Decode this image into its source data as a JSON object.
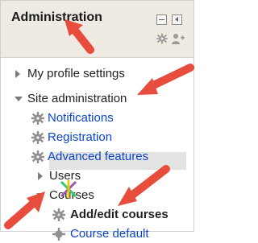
{
  "block": {
    "title": "Administration",
    "header_icons": [
      "dock-icon",
      "hide-icon",
      "gear-icon",
      "add-person-icon"
    ]
  },
  "tree": {
    "my_profile_settings": "My profile settings",
    "site_administration": "Site administration",
    "notifications": "Notifications",
    "registration": "Registration",
    "advanced_features": "Advanced features",
    "users": "Users",
    "courses": "Courses",
    "add_edit_courses": "Add/edit courses",
    "course_default_partial": "Course default"
  },
  "colors": {
    "link": "#0a45c7",
    "header_bg": "#efeae2",
    "highlight_bg": "#e3e3e3",
    "arrow": "#e74c3c",
    "gear": "#8f8f8f"
  }
}
